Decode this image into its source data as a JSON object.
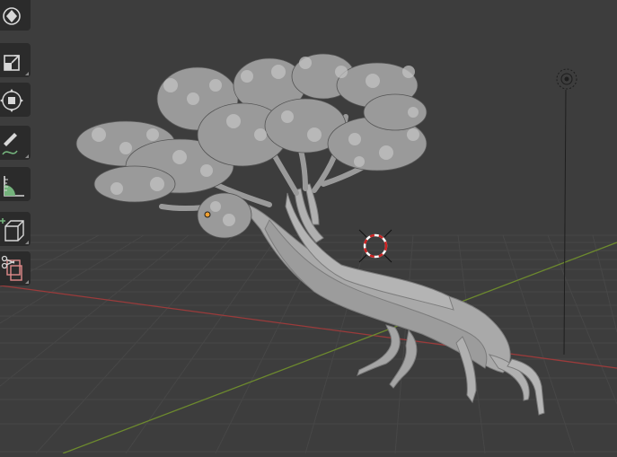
{
  "app": "3D viewport",
  "viewport": {
    "grid_color": "#4a4a4a",
    "background": "#3d3d3d",
    "x_axis_color": "#9b3b3b",
    "y_axis_color": "#6d8a2e"
  },
  "toolbar": {
    "tools": [
      {
        "name": "rotate-icon"
      },
      {
        "name": "scale-icon"
      },
      {
        "name": "transform-icon"
      },
      {
        "name": "annotate-icon"
      },
      {
        "name": "measure-icon"
      },
      {
        "name": "add-cube-icon"
      },
      {
        "name": "shear-icon"
      }
    ]
  },
  "scene": {
    "objects": [
      "tree-mesh",
      "light",
      "3d-cursor",
      "origin-point"
    ]
  }
}
